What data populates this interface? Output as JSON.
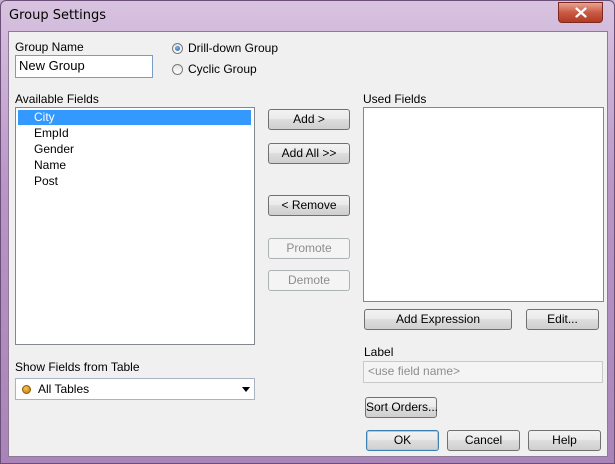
{
  "window": {
    "title": "Group Settings"
  },
  "group_name": {
    "label": "Group Name",
    "value": "New Group"
  },
  "group_type": {
    "options": [
      {
        "label": "Drill-down Group",
        "selected": true
      },
      {
        "label": "Cyclic Group",
        "selected": false
      }
    ]
  },
  "available_fields": {
    "label": "Available Fields",
    "items": [
      "City",
      "EmpId",
      "Gender",
      "Name",
      "Post"
    ],
    "selected": "City"
  },
  "used_fields": {
    "label": "Used Fields",
    "items": []
  },
  "buttons": {
    "add": "Add >",
    "add_all": "Add All >>",
    "remove": "< Remove",
    "promote": "Promote",
    "demote": "Demote",
    "add_expression": "Add Expression",
    "edit": "Edit...",
    "sort_orders": "Sort Orders...",
    "ok": "OK",
    "cancel": "Cancel",
    "help": "Help"
  },
  "label_field": {
    "label": "Label",
    "placeholder": "<use field name>"
  },
  "show_fields": {
    "label": "Show Fields from Table",
    "value": "All Tables"
  },
  "colors": {
    "selection": "#3399ff",
    "title_bar": "#b996c6",
    "close_button": "#c95a45"
  }
}
